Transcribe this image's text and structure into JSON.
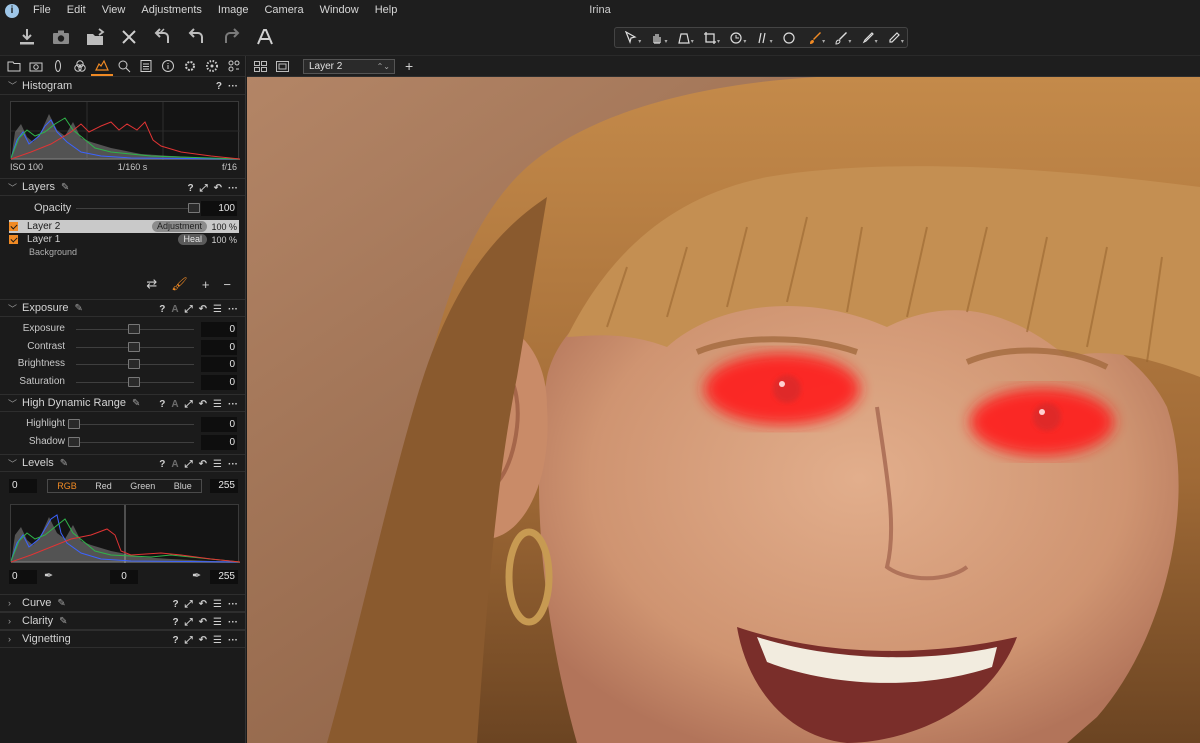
{
  "window": {
    "title": "Irina"
  },
  "menu": [
    "File",
    "Edit",
    "View",
    "Adjustments",
    "Image",
    "Camera",
    "Window",
    "Help"
  ],
  "toolbar": {
    "left_icons": [
      "import-icon",
      "camera-icon",
      "export-icon",
      "delete-icon",
      "undo-all-icon",
      "undo-icon",
      "redo-icon",
      "text-annotation-icon"
    ],
    "cursor_tools": [
      "select-cursor-icon",
      "pan-hand-icon",
      "keystone-icon",
      "crop-icon",
      "rotate-icon",
      "straighten-icon",
      "spot-removal-icon",
      "draw-mask-brush-icon",
      "erase-mask-icon",
      "color-picker-icon",
      "annotation-pen-icon"
    ],
    "active_tool": "draw-mask-brush-icon"
  },
  "colors": {
    "accent": "#f08a24",
    "mask_red": "#ff1e1e",
    "panel_bg": "#1b1b1b"
  },
  "tool_tabs": [
    "library-icon",
    "capture-icon",
    "lens-icon",
    "color-icon",
    "exposure-icon",
    "details-icon",
    "metadata-icon",
    "output-icon",
    "adjustments-icon",
    "settings-icon",
    "batch-icon"
  ],
  "histogram": {
    "title": "Histogram",
    "iso": "ISO 100",
    "shutter": "1/160 s",
    "aperture": "f/16"
  },
  "layers": {
    "title": "Layers",
    "opacity_label": "Opacity",
    "opacity_value": "100",
    "opacity_fraction": 1.0,
    "items": [
      {
        "name": "Layer 2",
        "type": "Adjustment",
        "opacity": "100 %",
        "selected": true
      },
      {
        "name": "Layer 1",
        "type": "Heal",
        "opacity": "100 %",
        "selected": false
      }
    ],
    "background_label": "Background"
  },
  "exposure": {
    "title": "Exposure",
    "rows": [
      {
        "label": "Exposure",
        "value": "0"
      },
      {
        "label": "Contrast",
        "value": "0"
      },
      {
        "label": "Brightness",
        "value": "0"
      },
      {
        "label": "Saturation",
        "value": "0"
      }
    ]
  },
  "hdr": {
    "title": "High Dynamic Range",
    "rows": [
      {
        "label": "Highlight",
        "value": "0"
      },
      {
        "label": "Shadow",
        "value": "0"
      }
    ]
  },
  "levels": {
    "title": "Levels",
    "input_low": "0",
    "input_high": "255",
    "channels": [
      "RGB",
      "Red",
      "Green",
      "Blue"
    ],
    "active_channel": "RGB",
    "output_low": "0",
    "midpoint": "0",
    "output_high": "255"
  },
  "collapsed_sections": [
    "Curve",
    "Clarity",
    "Vignetting"
  ],
  "view_bar": {
    "layer_select": "Layer 2",
    "add_layer": "+"
  }
}
